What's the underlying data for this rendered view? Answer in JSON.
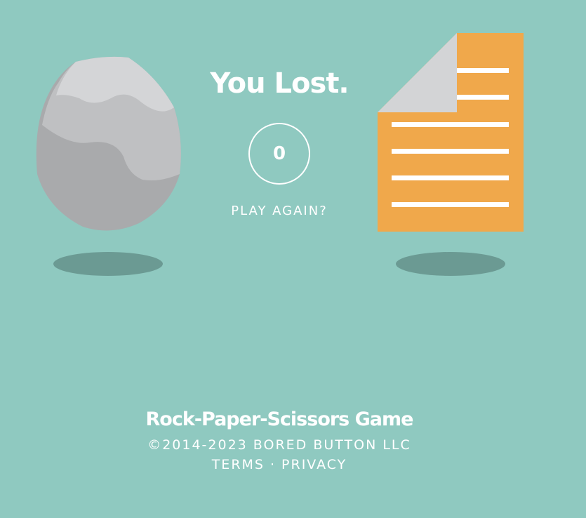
{
  "game": {
    "result_title": "You Lost.",
    "score": "0",
    "play_again_label": "PLAY AGAIN?",
    "player_choice": "rock-icon",
    "computer_choice": "paper-icon"
  },
  "footer": {
    "title": "Rock-Paper-Scissors Game",
    "copyright": "©2014-2023 BORED BUTTON LLC",
    "terms_label": "TERMS",
    "separator": "·",
    "privacy_label": "PRIVACY"
  },
  "colors": {
    "background": "#8fc9c0",
    "shadow": "#6b9a93",
    "paper": "#f0a84b",
    "paper_fold": "#d3d4d6",
    "rock_light": "#d4d5d7",
    "rock_mid": "#bfc0c2",
    "rock_dark": "#a9aaac",
    "text": "#ffffff"
  }
}
